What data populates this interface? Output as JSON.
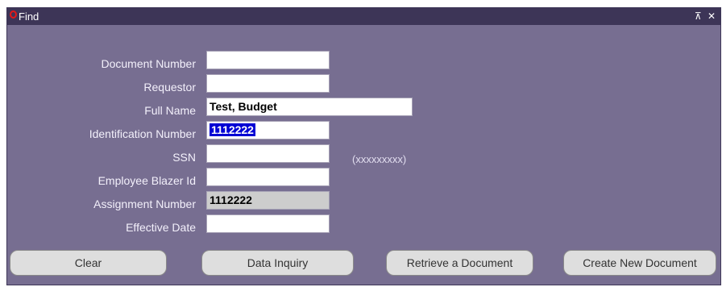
{
  "window": {
    "title": "Find",
    "controls": "⊼ ✕"
  },
  "fields": [
    {
      "label": "Document Number",
      "value": ""
    },
    {
      "label": "Requestor",
      "value": ""
    },
    {
      "label": "Full Name",
      "value": "Test, Budget"
    },
    {
      "label": "Identification Number",
      "value": "1112222"
    },
    {
      "label": "SSN",
      "value": "",
      "hint": "(xxxxxxxxx)"
    },
    {
      "label": "Employee Blazer Id",
      "value": ""
    },
    {
      "label": "Assignment Number",
      "value": "1112222"
    },
    {
      "label": "Effective Date",
      "value": ""
    }
  ],
  "buttons": {
    "clear": "Clear",
    "data_inquiry": "Data Inquiry",
    "retrieve": "Retrieve a Document",
    "create": "Create New Document"
  }
}
